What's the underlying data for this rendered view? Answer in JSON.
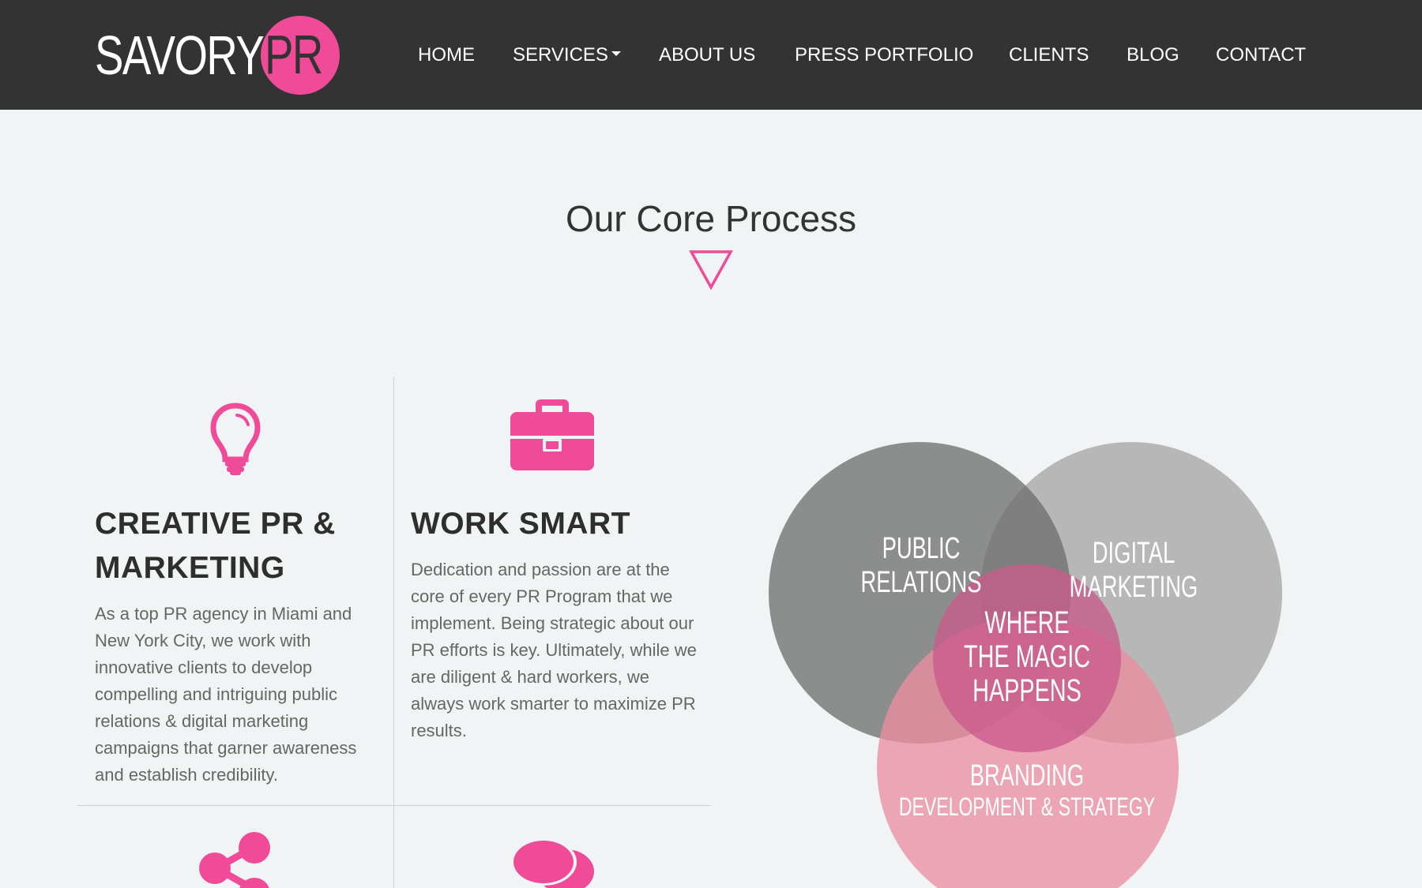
{
  "header": {
    "logo": {
      "text": "SAVORY",
      "accent": "PR"
    },
    "nav": [
      {
        "label": "HOME"
      },
      {
        "label": "SERVICES",
        "has_dropdown": true
      },
      {
        "label": "ABOUT US"
      },
      {
        "label": "PRESS PORTFOLIO"
      },
      {
        "label": "CLIENTS"
      },
      {
        "label": "BLOG"
      },
      {
        "label": "CONTACT"
      }
    ]
  },
  "section": {
    "title": "Our Core Process"
  },
  "cards": [
    {
      "icon": "lightbulb-icon",
      "heading_line1": "CREATIVE PR &",
      "heading_line2": "MARKETING",
      "text": "As a top PR agency in Miami and New York City, we work with innovative clients to develop compelling and intriguing public relations & digital marketing campaigns that garner awareness and establish credibility."
    },
    {
      "icon": "briefcase-icon",
      "heading_line1": "WORK SMART",
      "text": "Dedication and passion are at the core of every PR Program that we implement. Being strategic about our PR efforts is key. Ultimately, while we are diligent & hard workers, we always work smarter to maximize PR results."
    },
    {
      "icon": "share-icon"
    },
    {
      "icon": "chat-bubbles-icon"
    }
  ],
  "venn": {
    "public_relations": {
      "line1": "PUBLIC",
      "line2": "RELATIONS"
    },
    "digital_marketing": {
      "line1": "DIGITAL",
      "line2": "MARKETING"
    },
    "center": {
      "line1": "WHERE",
      "line2": "THE MAGIC",
      "line3": "HAPPENS"
    },
    "branding": {
      "line1": "BRANDING",
      "line2": "DEVELOPMENT & STRATEGY"
    }
  },
  "colors": {
    "accent": "#ef4b98",
    "header_bg": "#333333",
    "page_bg": "#f1f4f4",
    "circle_dark": "#7a7a7a",
    "circle_light": "#aaaaaa",
    "circle_pink": "#ec97a8",
    "center_pink": "#c45a8a"
  }
}
